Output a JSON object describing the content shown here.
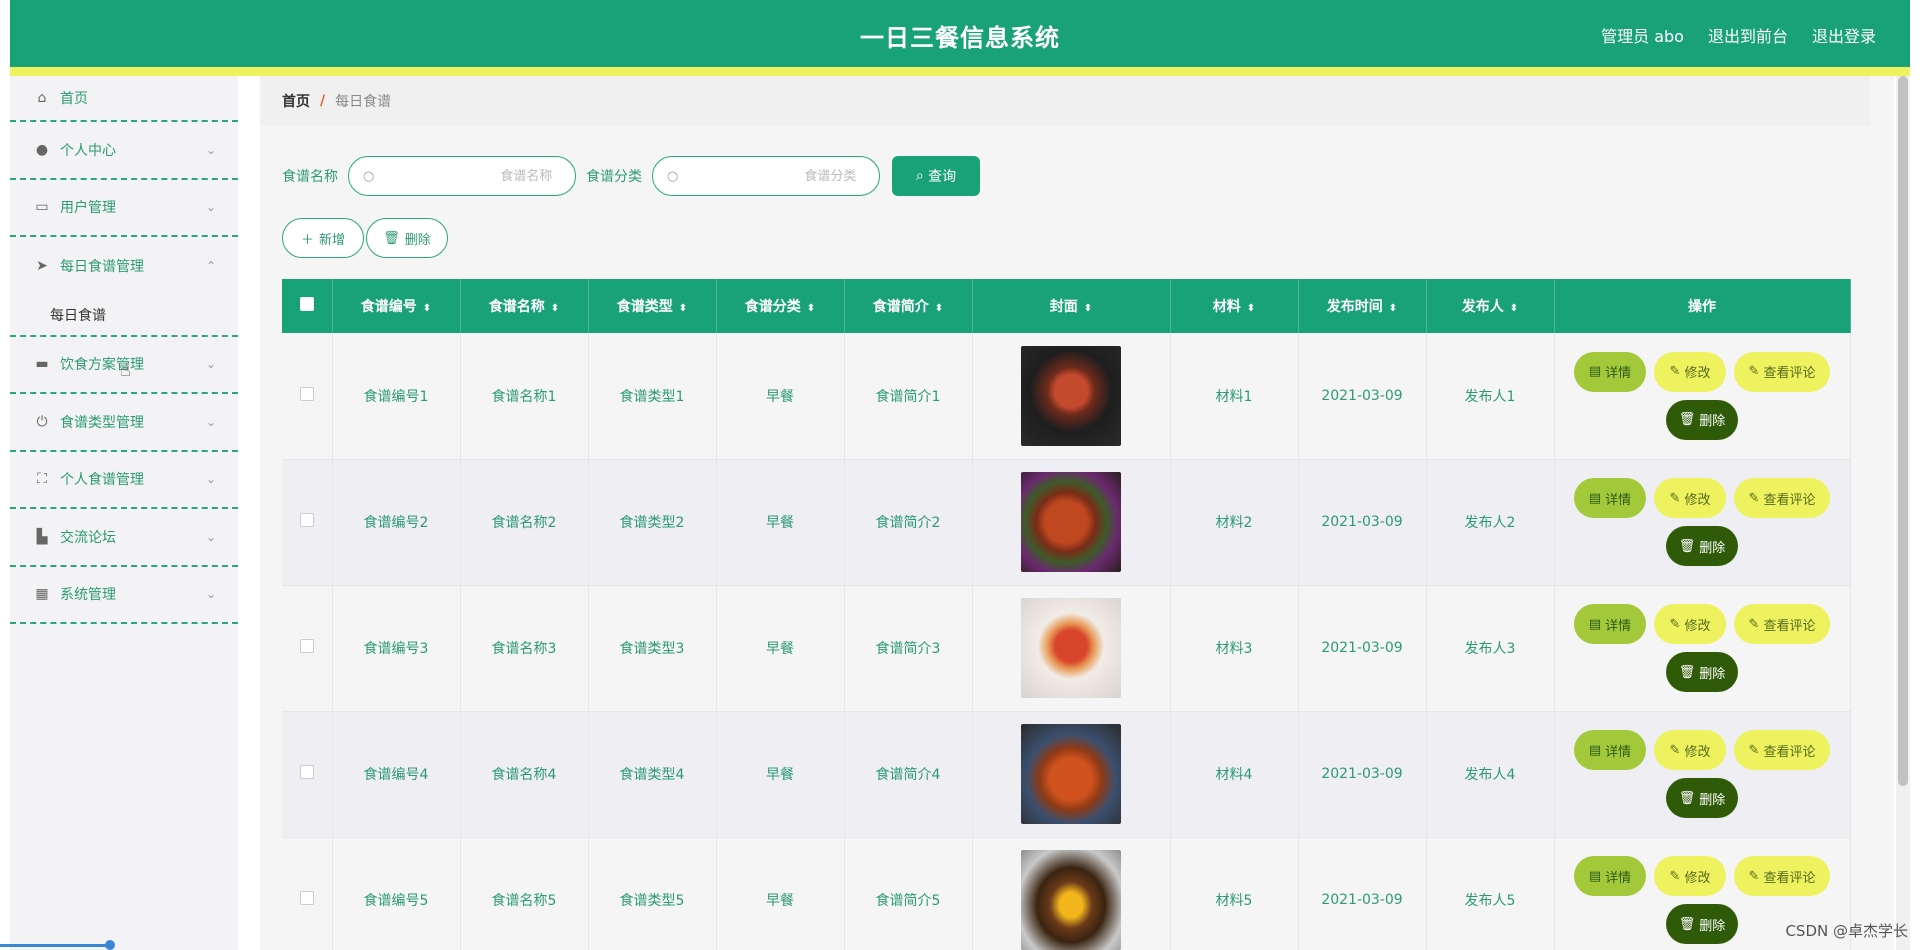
{
  "header": {
    "title": "一日三餐信息系统",
    "admin": "管理员 abo",
    "to_front": "退出到前台",
    "logout": "退出登录"
  },
  "sidebar": {
    "items": [
      {
        "label": "首页",
        "icon": "home-icon"
      },
      {
        "label": "个人中心",
        "icon": "user-icon"
      },
      {
        "label": "用户管理",
        "icon": "idcard-icon"
      },
      {
        "label": "每日食谱管理",
        "icon": "send-icon",
        "expanded": true,
        "sub": "每日食谱"
      },
      {
        "label": "饮食方案管理",
        "icon": "monitor-icon"
      },
      {
        "label": "食谱类型管理",
        "icon": "power-icon"
      },
      {
        "label": "个人食谱管理",
        "icon": "frame-icon"
      },
      {
        "label": "交流论坛",
        "icon": "forum-icon"
      },
      {
        "label": "系统管理",
        "icon": "grid-icon"
      }
    ]
  },
  "breadcrumb": {
    "home": "首页",
    "sep": "/",
    "current": "每日食谱"
  },
  "search": {
    "name_label": "食谱名称",
    "name_placeholder": "食谱名称",
    "category_label": "食谱分类",
    "category_placeholder": "食谱分类",
    "query_label": "查询"
  },
  "toolbar": {
    "add_label": "新增",
    "delete_label": "删除"
  },
  "table": {
    "headers": [
      "食谱编号",
      "食谱名称",
      "食谱类型",
      "食谱分类",
      "食谱简介",
      "封面",
      "材料",
      "发布时间",
      "发布人",
      "操作"
    ],
    "ops": {
      "detail": "详情",
      "edit": "修改",
      "review": "查看评论",
      "delete": "删除"
    },
    "rows": [
      {
        "code": "食谱编号1",
        "name": "食谱名称1",
        "type": "食谱类型1",
        "category": "早餐",
        "intro": "食谱简介1",
        "material": "材料1",
        "date": "2021-03-09",
        "publisher": "发布人1"
      },
      {
        "code": "食谱编号2",
        "name": "食谱名称2",
        "type": "食谱类型2",
        "category": "早餐",
        "intro": "食谱简介2",
        "material": "材料2",
        "date": "2021-03-09",
        "publisher": "发布人2"
      },
      {
        "code": "食谱编号3",
        "name": "食谱名称3",
        "type": "食谱类型3",
        "category": "早餐",
        "intro": "食谱简介3",
        "material": "材料3",
        "date": "2021-03-09",
        "publisher": "发布人3"
      },
      {
        "code": "食谱编号4",
        "name": "食谱名称4",
        "type": "食谱类型4",
        "category": "早餐",
        "intro": "食谱简介4",
        "material": "材料4",
        "date": "2021-03-09",
        "publisher": "发布人4"
      },
      {
        "code": "食谱编号5",
        "name": "食谱名称5",
        "type": "食谱类型5",
        "category": "早餐",
        "intro": "食谱简介5",
        "material": "材料5",
        "date": "2021-03-09",
        "publisher": "发布人5"
      }
    ]
  },
  "watermark": "CSDN @卓杰学长",
  "colors": {
    "primary": "#19a277",
    "accent_yellow": "#eef25f",
    "detail_green": "#a3c93a",
    "delete_dark": "#2f5b08"
  }
}
